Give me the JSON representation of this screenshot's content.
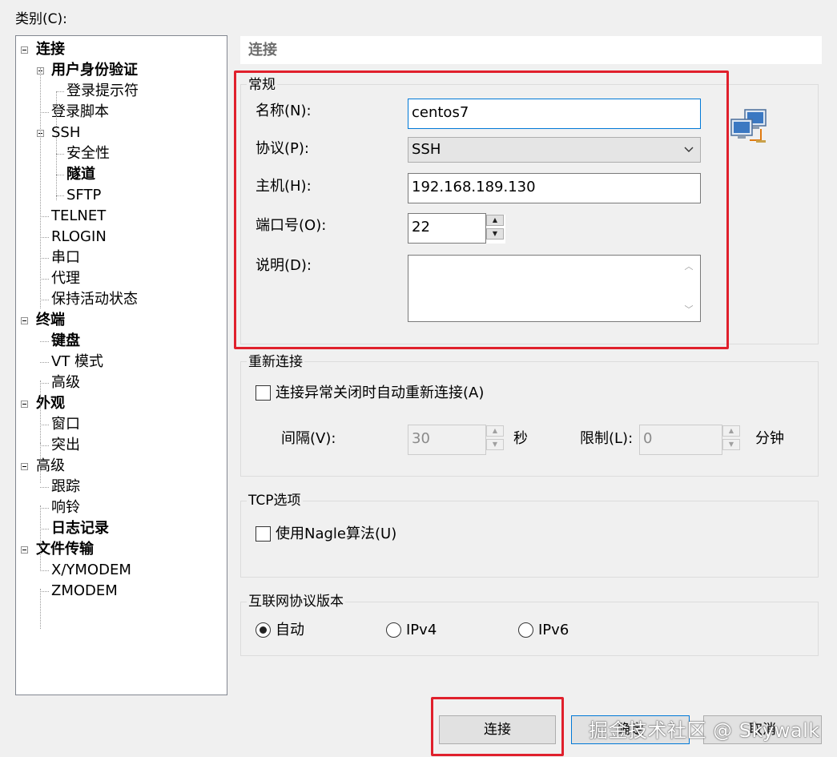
{
  "category_label": "类别(C):",
  "tree": [
    {
      "label": "连接",
      "bold": true,
      "expander": true
    },
    {
      "label": "用户身份验证",
      "bold": true,
      "expander": true
    },
    {
      "label": "登录提示符",
      "bold": false,
      "expander": false
    },
    {
      "label": "登录脚本",
      "bold": false,
      "expander": false
    },
    {
      "label": "SSH",
      "bold": false,
      "expander": true
    },
    {
      "label": "安全性",
      "bold": false,
      "expander": false
    },
    {
      "label": "隧道",
      "bold": true,
      "expander": false
    },
    {
      "label": "SFTP",
      "bold": false,
      "expander": false
    },
    {
      "label": "TELNET",
      "bold": false,
      "expander": false
    },
    {
      "label": "RLOGIN",
      "bold": false,
      "expander": false
    },
    {
      "label": "串口",
      "bold": false,
      "expander": false
    },
    {
      "label": "代理",
      "bold": false,
      "expander": false
    },
    {
      "label": "保持活动状态",
      "bold": false,
      "expander": false
    },
    {
      "label": "终端",
      "bold": true,
      "expander": true
    },
    {
      "label": "键盘",
      "bold": true,
      "expander": false
    },
    {
      "label": "VT 模式",
      "bold": false,
      "expander": false
    },
    {
      "label": "高级",
      "bold": false,
      "expander": false
    },
    {
      "label": "外观",
      "bold": true,
      "expander": true
    },
    {
      "label": "窗口",
      "bold": false,
      "expander": false
    },
    {
      "label": "突出",
      "bold": false,
      "expander": false
    },
    {
      "label": "高级",
      "bold": false,
      "expander": true
    },
    {
      "label": "跟踪",
      "bold": false,
      "expander": false
    },
    {
      "label": "响铃",
      "bold": false,
      "expander": false
    },
    {
      "label": "日志记录",
      "bold": true,
      "expander": false
    },
    {
      "label": "文件传输",
      "bold": true,
      "expander": true
    },
    {
      "label": "X/YMODEM",
      "bold": false,
      "expander": false
    },
    {
      "label": "ZMODEM",
      "bold": false,
      "expander": false
    }
  ],
  "section_title": "连接",
  "general": {
    "title": "常规",
    "name_label": "名称(N):",
    "name_value": "centos7",
    "protocol_label": "协议(P):",
    "protocol_value": "SSH",
    "host_label": "主机(H):",
    "host_value": "192.168.189.130",
    "port_label": "端口号(O):",
    "port_value": "22",
    "desc_label": "说明(D):",
    "desc_value": ""
  },
  "reconnect": {
    "title": "重新连接",
    "auto_label": "连接异常关闭时自动重新连接(A)",
    "auto_checked": false,
    "interval_label": "间隔(V):",
    "interval_value": "30",
    "seconds_label": "秒",
    "limit_label": "限制(L):",
    "limit_value": "0",
    "minutes_label": "分钟"
  },
  "tcp": {
    "title": "TCP选项",
    "nagle_label": "使用Nagle算法(U)",
    "nagle_checked": false
  },
  "ip_version": {
    "title": "互联网协议版本",
    "options": [
      "自动",
      "IPv4",
      "IPv6"
    ],
    "selected": "自动"
  },
  "buttons": {
    "connect": "连接",
    "ok": "确定",
    "cancel": "取消"
  },
  "icons": {
    "network": "network-computers-icon"
  },
  "colors": {
    "highlight_box": "#e0202c",
    "focus_border": "#0078d7"
  },
  "watermark": "掘金技术社区 @ Skywalk"
}
